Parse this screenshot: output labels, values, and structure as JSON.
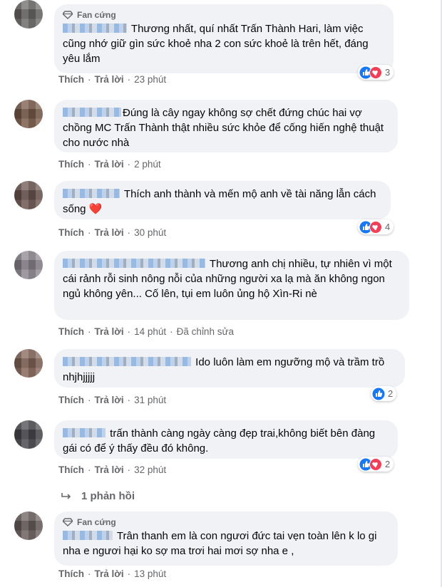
{
  "comments": [
    {
      "badge": "Fan cứng",
      "text": "Thương nhất, quí nhất Trấn Thành Hari, làm việc cũng nhớ giữ gìn sức khoẻ nha 2 con sức khoẻ là trên hết, đáng yêu lắm",
      "like": "Thích",
      "reply": "Trả lời",
      "time": "23 phút",
      "reactions": [
        "like",
        "love"
      ],
      "reaction_count": "3",
      "avatar_color": "#6e6a6a"
    },
    {
      "badge": "",
      "text": "Đúng là cây ngay không sợ chết đứng chúc hai vợ chồng MC Trấn Thành thật nhiều sức khỏe để cống hiến nghệ thuật cho nước nhà",
      "like": "Thích",
      "reply": "Trả lời",
      "time": "2 phút",
      "reactions": [],
      "reaction_count": "",
      "avatar_color": "#7a5c4a"
    },
    {
      "badge": "",
      "text": "Thích anh thành và mến mộ anh về tài năng lẫn cách sống ❤️",
      "like": "Thích",
      "reply": "Trả lời",
      "time": "30 phút",
      "reactions": [
        "like",
        "love"
      ],
      "reaction_count": "4",
      "avatar_color": "#6d5651"
    },
    {
      "badge": "",
      "text": "Thương anh chị nhiều, tự nhiên vì một cái rảnh rỗi sinh nông nỗi của những người xa lạ mà ăn không ngon ngủ không yên... Cố lên, tụi em luôn ủng hộ Xìn-Ri nè",
      "like": "Thích",
      "reply": "Trả lời",
      "time": "14 phút",
      "edited": "Đã chỉnh sửa",
      "reactions": [],
      "reaction_count": "",
      "avatar_color": "#8e8790"
    },
    {
      "badge": "",
      "text": "Ido luôn làm em ngưỡng mộ và trầm trồ nhjhjjjjj",
      "like": "Thích",
      "reply": "Trả lời",
      "time": "31 phút",
      "reactions": [
        "like"
      ],
      "reaction_count": "2",
      "avatar_color": "#86665a"
    },
    {
      "badge": "",
      "text": "trấn thành càng ngày càng đẹp trai,không biết bên đàng gái có để ý thấy đều đó không.",
      "like": "Thích",
      "reply": "Trả lời",
      "time": "32 phút",
      "reactions": [
        "like",
        "love"
      ],
      "reaction_count": "2",
      "avatar_color": "#4b4b50"
    },
    {
      "badge": "Fan cứng",
      "text": "Trân thanh em là con ngươi đức tai vẹn toàn lên k lo gi nha e ngươi hại ko sợ ma trơi hai mơi sợ nha e ,",
      "like": "Thích",
      "reply": "Trả lời",
      "time": "13 phút",
      "reactions": [],
      "reaction_count": "",
      "avatar_color": "#6b605e"
    }
  ],
  "replies_link": "1 phản hồi",
  "colors": {
    "bubble": "#f0f2f5",
    "meta": "#65676b",
    "like_blue": "#1877f2",
    "love_red": "#f33e58"
  }
}
